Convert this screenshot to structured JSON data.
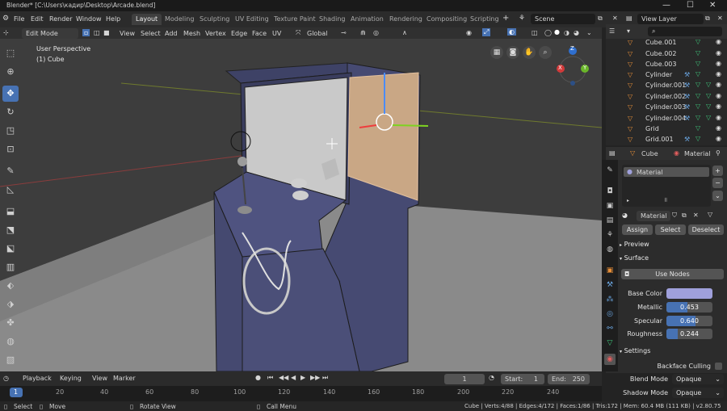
{
  "window": {
    "title": "Blender* [C:\\Users\\кадир\\Desktop\\Arcade.blend]",
    "minimize": "—",
    "maximize": "☐",
    "close": "✕"
  },
  "menu": {
    "items": [
      "File",
      "Edit",
      "Render",
      "Window",
      "Help"
    ],
    "tabs": [
      "Layout",
      "Modeling",
      "Sculpting",
      "UV Editing",
      "Texture Paint",
      "Shading",
      "Animation",
      "Rendering",
      "Compositing",
      "Scripting"
    ],
    "active_tab": "Layout",
    "add_tab": "+",
    "scene": "Scene",
    "view_layer": "View Layer"
  },
  "viewport_header": {
    "mode": "Edit Mode",
    "menus": [
      "View",
      "Select",
      "Add",
      "Mesh",
      "Vertex",
      "Edge",
      "Face",
      "UV"
    ],
    "orientation": "Global"
  },
  "viewport": {
    "perspective": "User Perspective",
    "object": "(1) Cube",
    "gizmo_x": "X",
    "gizmo_y": "Y",
    "gizmo_z": "Z"
  },
  "outliner": {
    "search_placeholder": "",
    "items": [
      {
        "name": "Cube.001"
      },
      {
        "name": "Cube.002"
      },
      {
        "name": "Cube.003"
      },
      {
        "name": "Cylinder"
      },
      {
        "name": "Cylinder.001"
      },
      {
        "name": "Cylinder.002"
      },
      {
        "name": "Cylinder.003"
      },
      {
        "name": "Cylinder.004"
      },
      {
        "name": "Grid"
      },
      {
        "name": "Grid.001"
      }
    ]
  },
  "properties": {
    "object_name": "Cube",
    "tab_label": "Material",
    "slot": "Material",
    "material_name": "Material",
    "buttons": {
      "assign": "Assign",
      "select": "Select",
      "deselect": "Deselect"
    },
    "sections": {
      "preview": "Preview",
      "surface": "Surface",
      "settings": "Settings"
    },
    "use_nodes": "Use Nodes",
    "base_color_label": "Base Color",
    "base_color": "#9fa0db",
    "metallic_label": "Metallic",
    "metallic": 0.453,
    "metallic_text": "0.453",
    "specular_label": "Specular",
    "specular": 0.64,
    "specular_text": "0.640",
    "roughness_label": "Roughness",
    "roughness": 0.244,
    "roughness_text": "0.244",
    "backface_culling": "Backface Culling",
    "blend_mode_label": "Blend Mode",
    "blend_mode": "Opaque",
    "shadow_mode_label": "Shadow Mode",
    "shadow_mode": "Opaque"
  },
  "timeline": {
    "menus": [
      "Playback",
      "Keying",
      "View",
      "Marker"
    ],
    "current_frame": "1",
    "start_label": "Start:",
    "start": "1",
    "end_label": "End:",
    "end": "250",
    "ruler": [
      "1",
      "20",
      "40",
      "60",
      "80",
      "100",
      "120",
      "140",
      "160",
      "180",
      "200",
      "220",
      "240"
    ]
  },
  "status": {
    "select": "Select",
    "move": "Move",
    "rotate": "Rotate View",
    "call_menu": "Call Menu",
    "stats": "Cube | Verts:4/88 | Edges:4/172 | Faces:1/86 | Tris:172 | Mem: 60.4 MB (111 KB) | v2.80.75"
  },
  "colors": {
    "accent": "#4772b3",
    "cabinet": "#4b4f78",
    "selected_face": "#c9a785"
  }
}
